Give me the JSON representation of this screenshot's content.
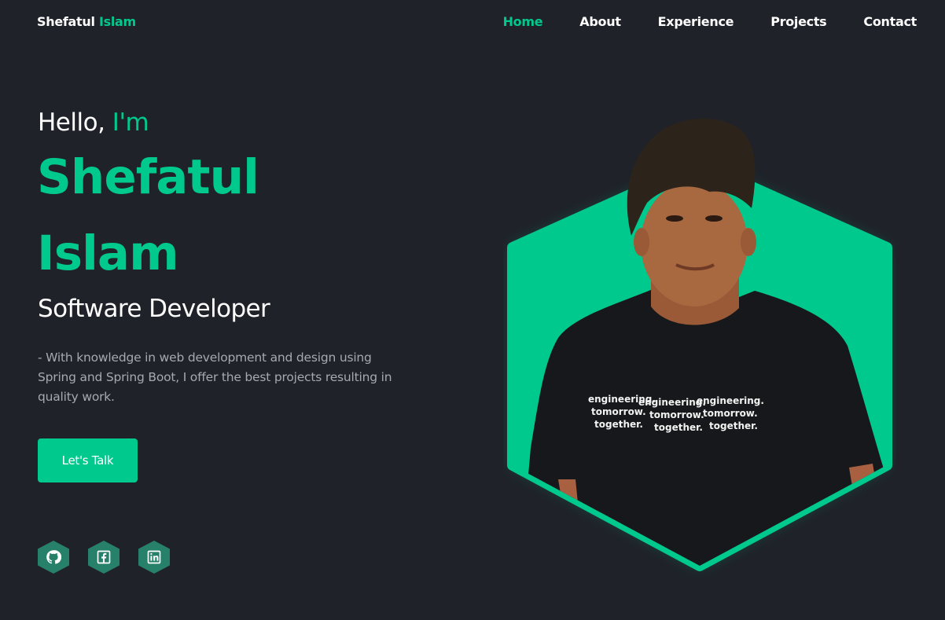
{
  "brand": {
    "first": "Shefatul",
    "last": "Islam"
  },
  "nav": {
    "items": [
      "Home",
      "About",
      "Experience",
      "Projects",
      "Contact"
    ],
    "active": "Home"
  },
  "hero": {
    "greeting": "Hello,",
    "greeting_accent": "I'm",
    "name_first": "Shefatul",
    "name_last": "Islam",
    "role": "Software Developer",
    "description": "- With knowledge in web development and design using Spring and Spring Boot, I offer the best projects resulting in quality work.",
    "cta_label": "Let's Talk",
    "shirt_text": [
      "engineering.",
      "tomorrow.",
      "together."
    ]
  },
  "socials": [
    {
      "icon": "github-icon"
    },
    {
      "icon": "facebook-icon"
    },
    {
      "icon": "linkedin-icon"
    }
  ],
  "colors": {
    "accent": "#00c98e",
    "background": "#1f2229",
    "muted_text": "#a7a9b0",
    "social_bg": "#27806a"
  }
}
